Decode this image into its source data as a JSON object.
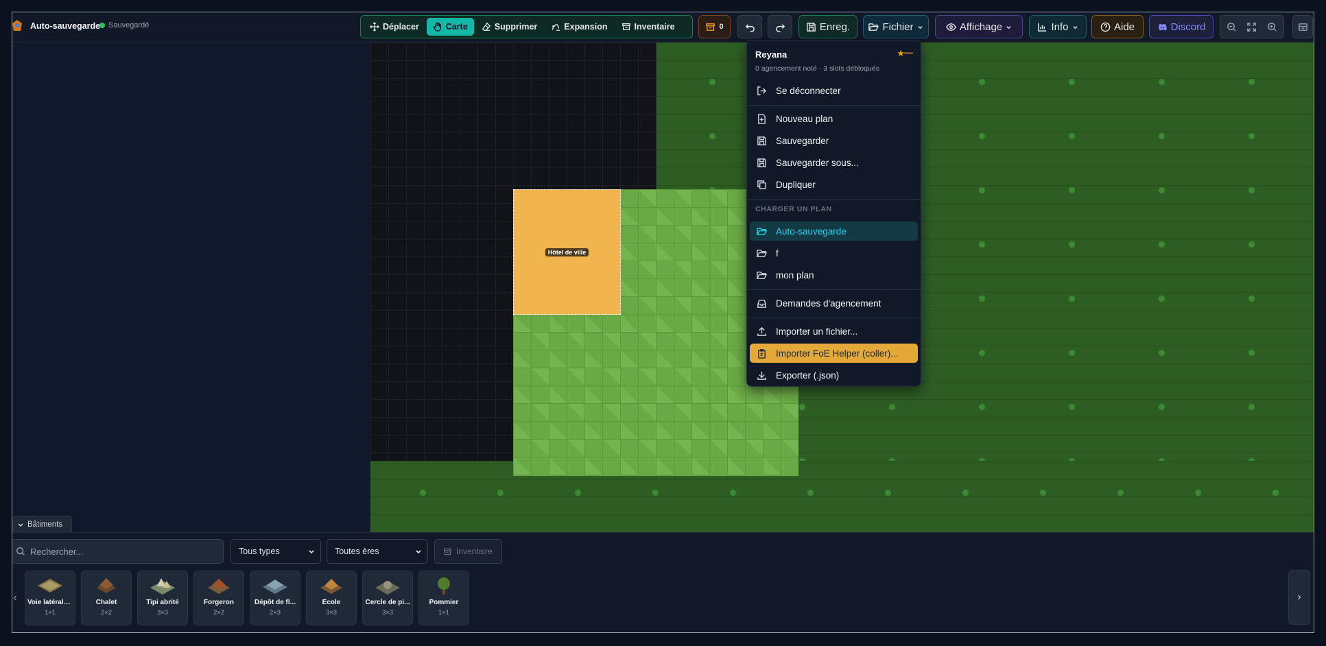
{
  "header": {
    "plan_title": "Auto-sauvegarde",
    "save_status": "Sauvegardé",
    "tools": [
      {
        "name": "move",
        "label": "Déplacer",
        "active": false
      },
      {
        "name": "map",
        "label": "Carte",
        "active": true
      },
      {
        "name": "delete",
        "label": "Supprimer",
        "active": false
      },
      {
        "name": "expansion",
        "label": "Expansion",
        "active": false
      },
      {
        "name": "inventory",
        "label": "Inventaire",
        "active": false
      }
    ],
    "archive_count": "0",
    "save_label": "Enreg.",
    "file_label": "Fichier",
    "display_label": "Affichage",
    "info_label": "Info",
    "help_label": "Aide",
    "discord_label": "Discord",
    "accent_color": "#14b8a6"
  },
  "canvas": {
    "building_label": "Hôtel de ville",
    "building_color": "#f2b44c"
  },
  "file_menu": {
    "user_name": "Reyana",
    "user_stats": "0 agencement noté · 3 slots débloqués",
    "rating_dash": "—",
    "items_top": [
      {
        "label": "Se déconnecter",
        "icon": "logout-icon"
      }
    ],
    "items_file": [
      {
        "label": "Nouveau plan",
        "icon": "new-file-icon"
      },
      {
        "label": "Sauvegarder",
        "icon": "save-icon"
      },
      {
        "label": "Sauvegarder sous...",
        "icon": "save-as-icon"
      },
      {
        "label": "Dupliquer",
        "icon": "duplicate-icon"
      }
    ],
    "section_label": "CHARGER UN PLAN",
    "plans": [
      {
        "label": "Auto-sauvegarde",
        "icon": "folder-open-icon",
        "selected": true
      },
      {
        "label": "f",
        "icon": "folder-open-icon",
        "selected": false
      },
      {
        "label": "mon plan",
        "icon": "folder-open-icon",
        "selected": false
      }
    ],
    "requests_label": "Demandes d'agencement",
    "import_file_label": "Importer un fichier...",
    "import_foe_label": "Importer FoE Helper (coller)...",
    "export_label": "Exporter (.json)"
  },
  "bottom": {
    "tab_label": "Bâtiments",
    "search_placeholder": "Rechercher...",
    "type_filter": "Tous types",
    "era_filter": "Toutes ères",
    "inventory_label": "Inventaire",
    "buildings": [
      {
        "name": "Voie latérale...",
        "size": "1×1"
      },
      {
        "name": "Chalet",
        "size": "2×2"
      },
      {
        "name": "Tipi abrité",
        "size": "3×3"
      },
      {
        "name": "Forgeron",
        "size": "2×2"
      },
      {
        "name": "Dépôt de fl...",
        "size": "2×3"
      },
      {
        "name": "École",
        "size": "3×3"
      },
      {
        "name": "Cercle de pi...",
        "size": "3×3"
      },
      {
        "name": "Pommier",
        "size": "1×1"
      }
    ]
  }
}
